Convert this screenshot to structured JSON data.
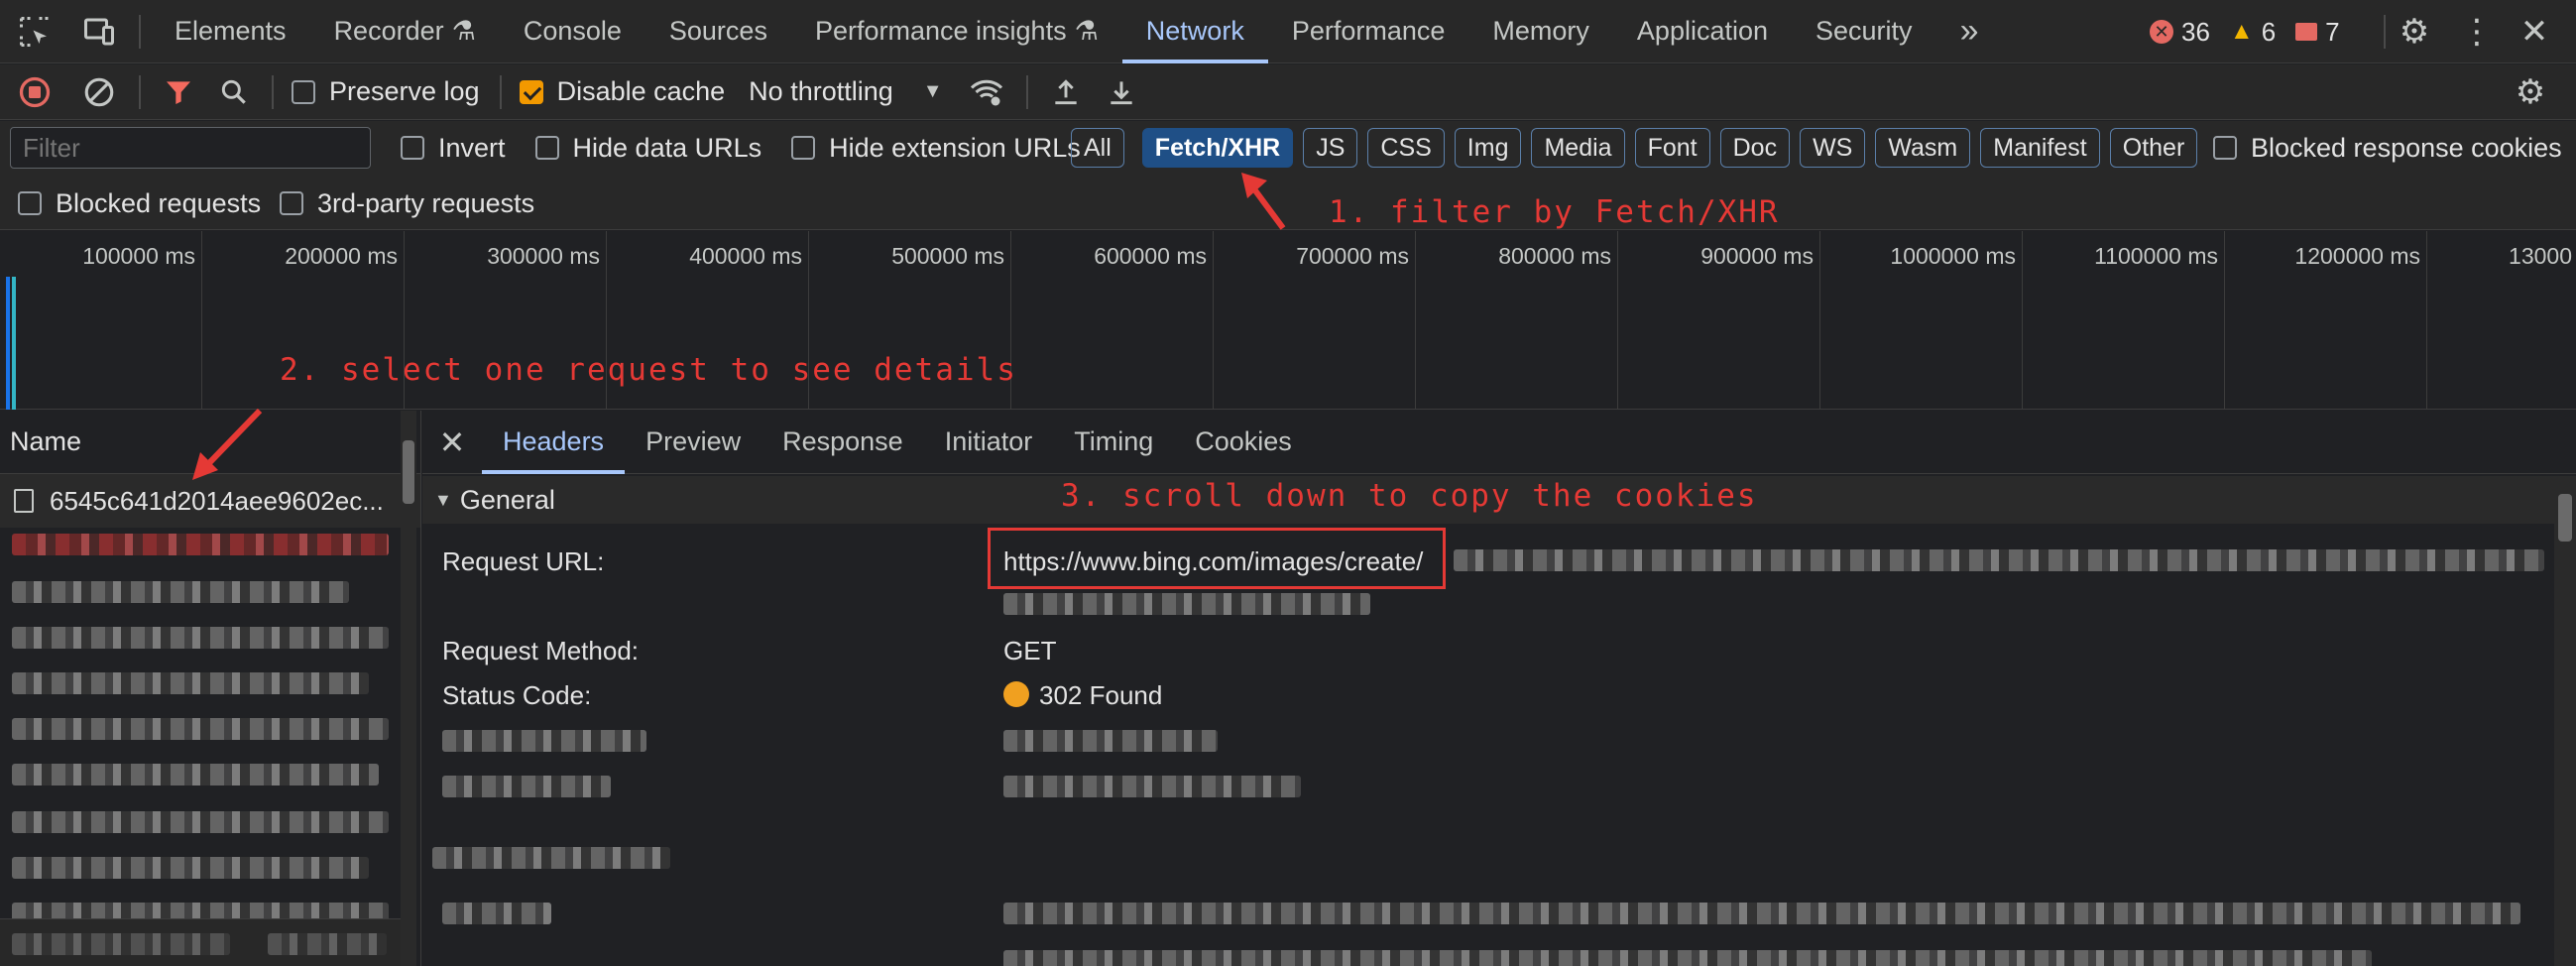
{
  "tabbar": {
    "tabs": [
      "Elements",
      "Recorder",
      "Console",
      "Sources",
      "Performance insights",
      "Network",
      "Performance",
      "Memory",
      "Application",
      "Security"
    ],
    "active": "Network",
    "more": "»",
    "errors": "36",
    "warnings": "6",
    "issues": "7"
  },
  "toolbar": {
    "preserve_log": "Preserve log",
    "disable_cache": "Disable cache",
    "throttling": "No throttling"
  },
  "filter": {
    "placeholder": "Filter",
    "invert": "Invert",
    "hide_data_urls": "Hide data URLs",
    "hide_extension_urls": "Hide extension URLs",
    "types": [
      "All",
      "Fetch/XHR",
      "JS",
      "CSS",
      "Img",
      "Media",
      "Font",
      "Doc",
      "WS",
      "Wasm",
      "Manifest",
      "Other"
    ],
    "active_type": "Fetch/XHR",
    "blocked_response_cookies": "Blocked response cookies",
    "blocked_requests": "Blocked requests",
    "third_party": "3rd-party requests"
  },
  "overview": {
    "ticks": [
      "100000 ms",
      "200000 ms",
      "300000 ms",
      "400000 ms",
      "500000 ms",
      "600000 ms",
      "700000 ms",
      "800000 ms",
      "900000 ms",
      "1000000 ms",
      "1100000 ms",
      "1200000 ms",
      "13000"
    ]
  },
  "annotations": {
    "step1": "1. filter by Fetch/XHR",
    "step2": "2. select one request to see details",
    "step3": "3. scroll down to copy the cookies"
  },
  "name_pane": {
    "header": "Name",
    "first_request": "6545c641d2014aee9602ec..."
  },
  "details": {
    "tabs": [
      "Headers",
      "Preview",
      "Response",
      "Initiator",
      "Timing",
      "Cookies"
    ],
    "active": "Headers",
    "section": "General",
    "request_url_label": "Request URL:",
    "request_url_value": "https://www.bing.com/images/create/",
    "method_label": "Request Method:",
    "method_value": "GET",
    "status_label": "Status Code:",
    "status_value": "302 Found",
    "status_color": "#f0a020"
  },
  "colors": {
    "accent": "#a8c7fa",
    "annotation": "#e53935",
    "record": "#e46962",
    "filter_icon": "#f46a5e"
  }
}
